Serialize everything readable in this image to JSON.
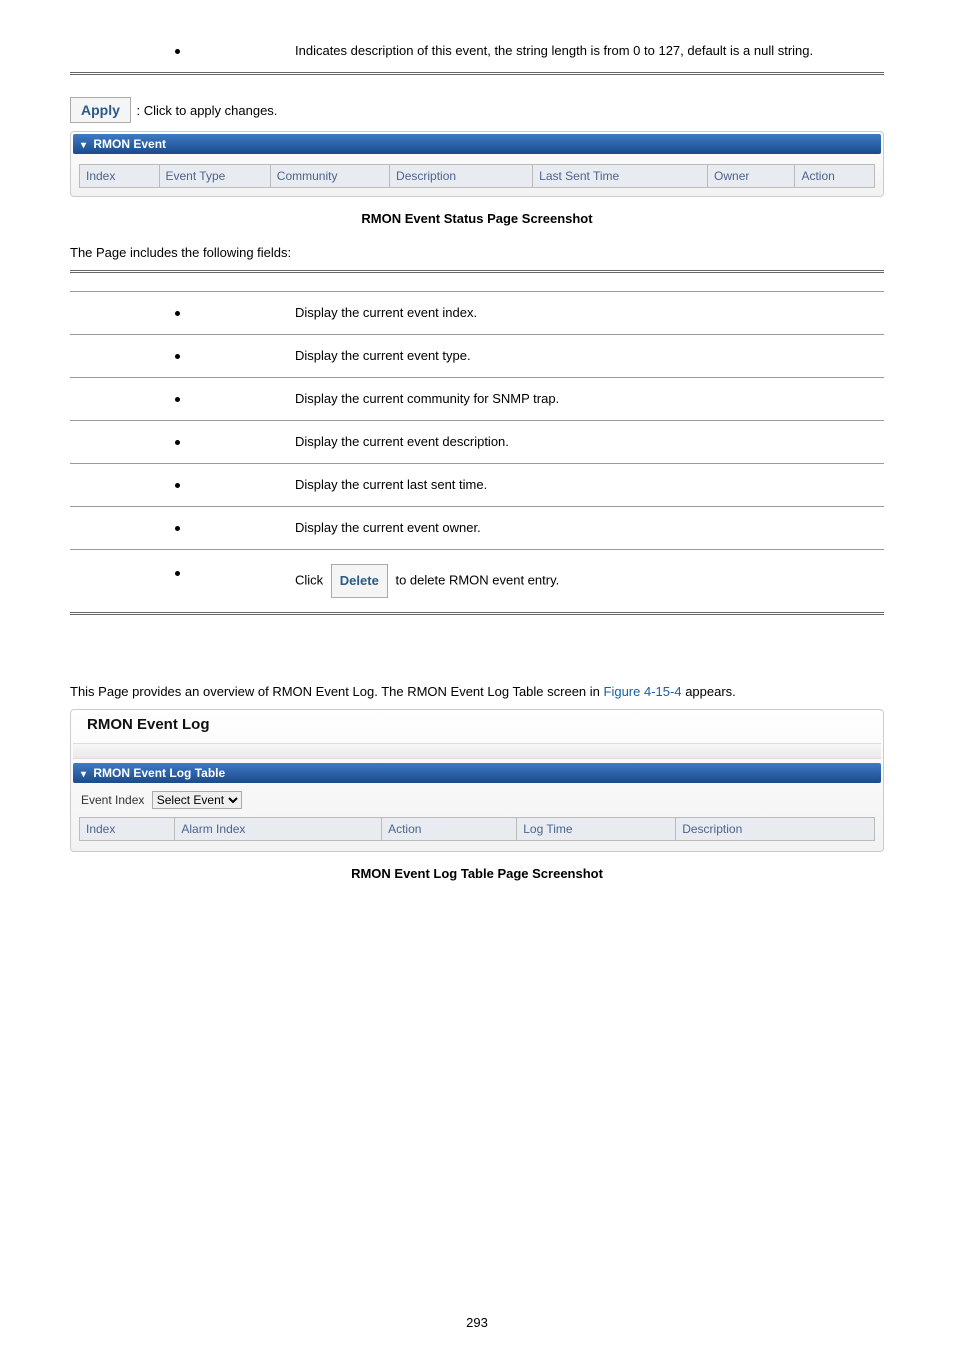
{
  "top_table": {
    "row1_desc": "Indicates description of this event, the string length is from 0 to 127, default is a null string."
  },
  "buttons": {
    "apply_label": "Apply",
    "apply_text": ": Click to apply changes.",
    "delete_label": "Delete"
  },
  "panel1": {
    "title": "RMON Event",
    "cols": [
      "Index",
      "Event Type",
      "Community",
      "Description",
      "Last Sent Time",
      "Owner",
      "Action"
    ]
  },
  "caption1_full": "RMON Event Status Page Screenshot",
  "intro2": "The Page includes the following fields:",
  "fields_table": {
    "rows": [
      "Display the current event index.",
      "Display the current event type.",
      "Display the current community for SNMP trap.",
      "Display the current event description.",
      "Display the current last sent time.",
      "Display the current event owner."
    ],
    "action_pre": "Click",
    "action_post": " to delete RMON event entry."
  },
  "section2": {
    "intro_pre": "This Page provides an overview of RMON Event Log. The RMON Event Log Table screen in ",
    "figref": "Figure 4-15-4",
    "intro_post": " appears."
  },
  "panel2": {
    "head": "RMON Event Log",
    "title": "RMON Event Log Table",
    "event_index_label": "Event Index",
    "select_text": "Select Event",
    "cols": [
      "Index",
      "Alarm Index",
      "Action",
      "Log Time",
      "Description"
    ]
  },
  "caption2_full": "RMON Event Log Table Page Screenshot",
  "page_num": "293"
}
